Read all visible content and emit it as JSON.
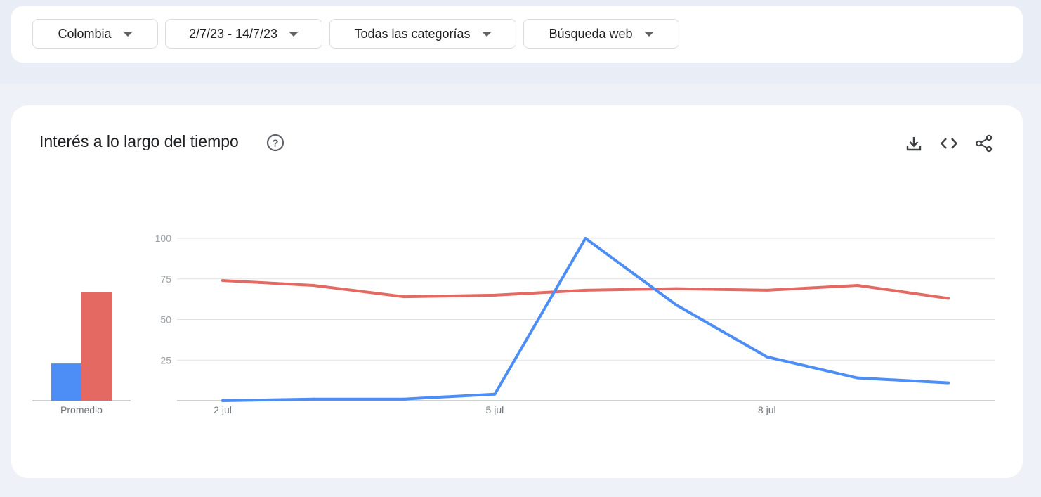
{
  "filters": {
    "region": "Colombia",
    "date_range": "2/7/23 - 14/7/23",
    "category": "Todas las categorías",
    "search_type": "Búsqueda web"
  },
  "card": {
    "title": "Interés a lo largo del tiempo"
  },
  "icons": {
    "help": "help-circle-icon",
    "download": "download-icon",
    "embed": "code-icon",
    "share": "share-icon"
  },
  "colors": {
    "series_blue": "#4c8df6",
    "series_red": "#e46962"
  },
  "chart_data": [
    {
      "type": "bar",
      "xlabel": "Promedio",
      "categories": [
        "Promedio"
      ],
      "series": [
        {
          "color": "#4c8df6",
          "values": [
            23
          ]
        },
        {
          "color": "#e46962",
          "values": [
            67
          ]
        }
      ],
      "ylim": [
        0,
        100
      ]
    },
    {
      "type": "line",
      "x": [
        "2023-07-02",
        "2023-07-03",
        "2023-07-04",
        "2023-07-05",
        "2023-07-06",
        "2023-07-07",
        "2023-07-08",
        "2023-07-09",
        "2023-07-10"
      ],
      "x_tick_labels": [
        "2 jul",
        "5 jul",
        "8 jul"
      ],
      "y_tick_labels": [
        "100",
        "75",
        "50",
        "25"
      ],
      "ylim": [
        0,
        100
      ],
      "grid": true,
      "series": [
        {
          "color": "#4c8df6",
          "values": [
            0,
            1,
            1,
            4,
            100,
            59,
            27,
            14,
            11
          ]
        },
        {
          "color": "#e46962",
          "values": [
            74,
            71,
            64,
            65,
            68,
            69,
            68,
            71,
            63
          ]
        }
      ]
    }
  ]
}
